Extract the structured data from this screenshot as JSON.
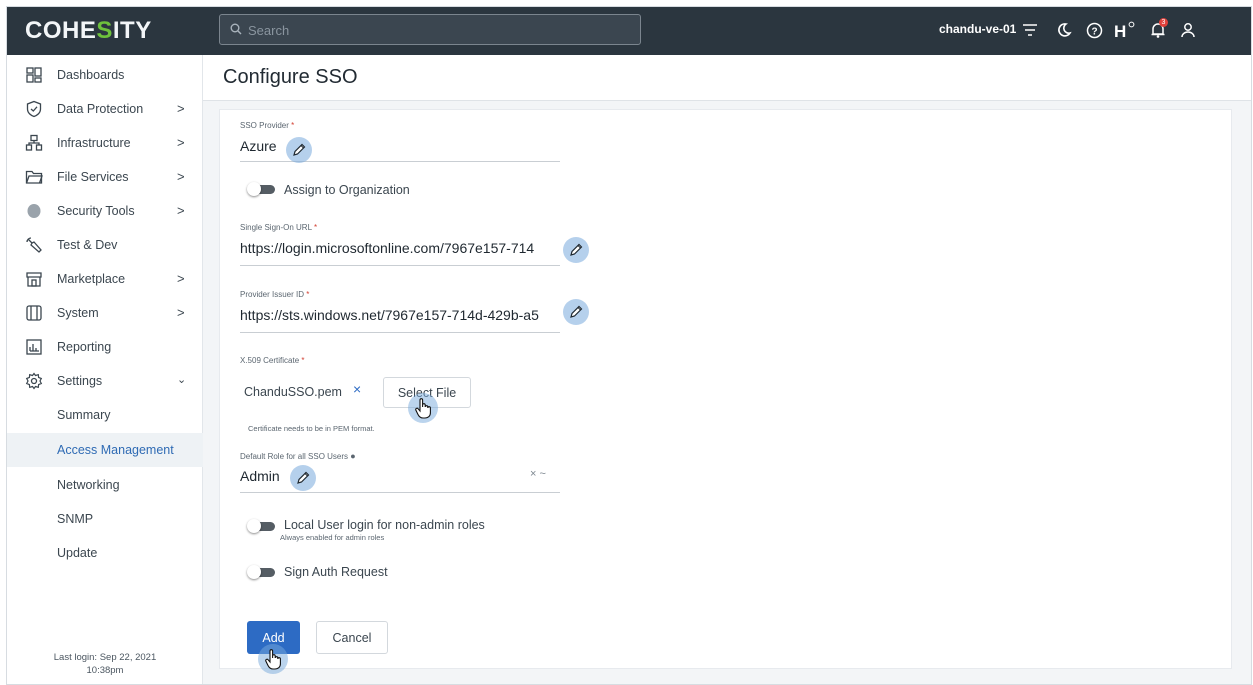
{
  "brand": {
    "logo_pre": "COHE",
    "logo_s": "S",
    "logo_post": "ITY",
    "accent": "#6ec23c"
  },
  "topbar": {
    "search_placeholder": "Search",
    "cluster_name": "chandu-ve-01",
    "notification_count": "3",
    "icons": [
      "filter-icon",
      "moon-icon",
      "help-icon",
      "helios-icon",
      "bell-icon",
      "user-icon"
    ]
  },
  "sidebar": {
    "items": [
      {
        "label": "Dashboards",
        "icon": "dashboard-icon",
        "chevron": ""
      },
      {
        "label": "Data Protection",
        "icon": "shield-icon",
        "chevron": ">"
      },
      {
        "label": "Infrastructure",
        "icon": "infrastructure-icon",
        "chevron": ">"
      },
      {
        "label": "File Services",
        "icon": "folder-icon",
        "chevron": ">"
      },
      {
        "label": "Security Tools",
        "icon": "security-icon",
        "chevron": ">"
      },
      {
        "label": "Test & Dev",
        "icon": "wrench-icon",
        "chevron": ""
      },
      {
        "label": "Marketplace",
        "icon": "store-icon",
        "chevron": ">"
      },
      {
        "label": "System",
        "icon": "system-icon",
        "chevron": ">"
      },
      {
        "label": "Reporting",
        "icon": "report-icon",
        "chevron": ""
      },
      {
        "label": "Settings",
        "icon": "gear-icon",
        "chevron": "v"
      }
    ],
    "settings_sub": [
      "Summary",
      "Access Management",
      "Networking",
      "SNMP",
      "Update"
    ],
    "active_sub": "Access Management",
    "last_login_line1": "Last login: Sep 22, 2021",
    "last_login_line2": "10:38pm"
  },
  "page": {
    "title": "Configure SSO"
  },
  "form": {
    "sso_provider_label": "SSO Provider",
    "sso_provider_value": "Azure",
    "assign_org_label": "Assign to Organization",
    "sso_url_label": "Single Sign-On URL",
    "sso_url_value": "https://login.microsoftonline.com/7967e157-714",
    "issuer_label": "Provider Issuer ID",
    "issuer_value": "https://sts.windows.net/7967e157-714d-429b-a5",
    "cert_label": "X.509 Certificate",
    "cert_file": "ChanduSSO.pem",
    "cert_remove": "×",
    "select_file": "Select File",
    "cert_hint": "Certificate needs to be in PEM format.",
    "role_label": "Default Role for all SSO Users",
    "role_value": "Admin",
    "role_clear": "× ~",
    "local_login_label": "Local User login for non-admin roles",
    "local_login_hint": "Always enabled for admin roles",
    "sign_auth_label": "Sign Auth Request",
    "required_mark": "*",
    "add_button": "Add",
    "cancel_button": "Cancel"
  }
}
